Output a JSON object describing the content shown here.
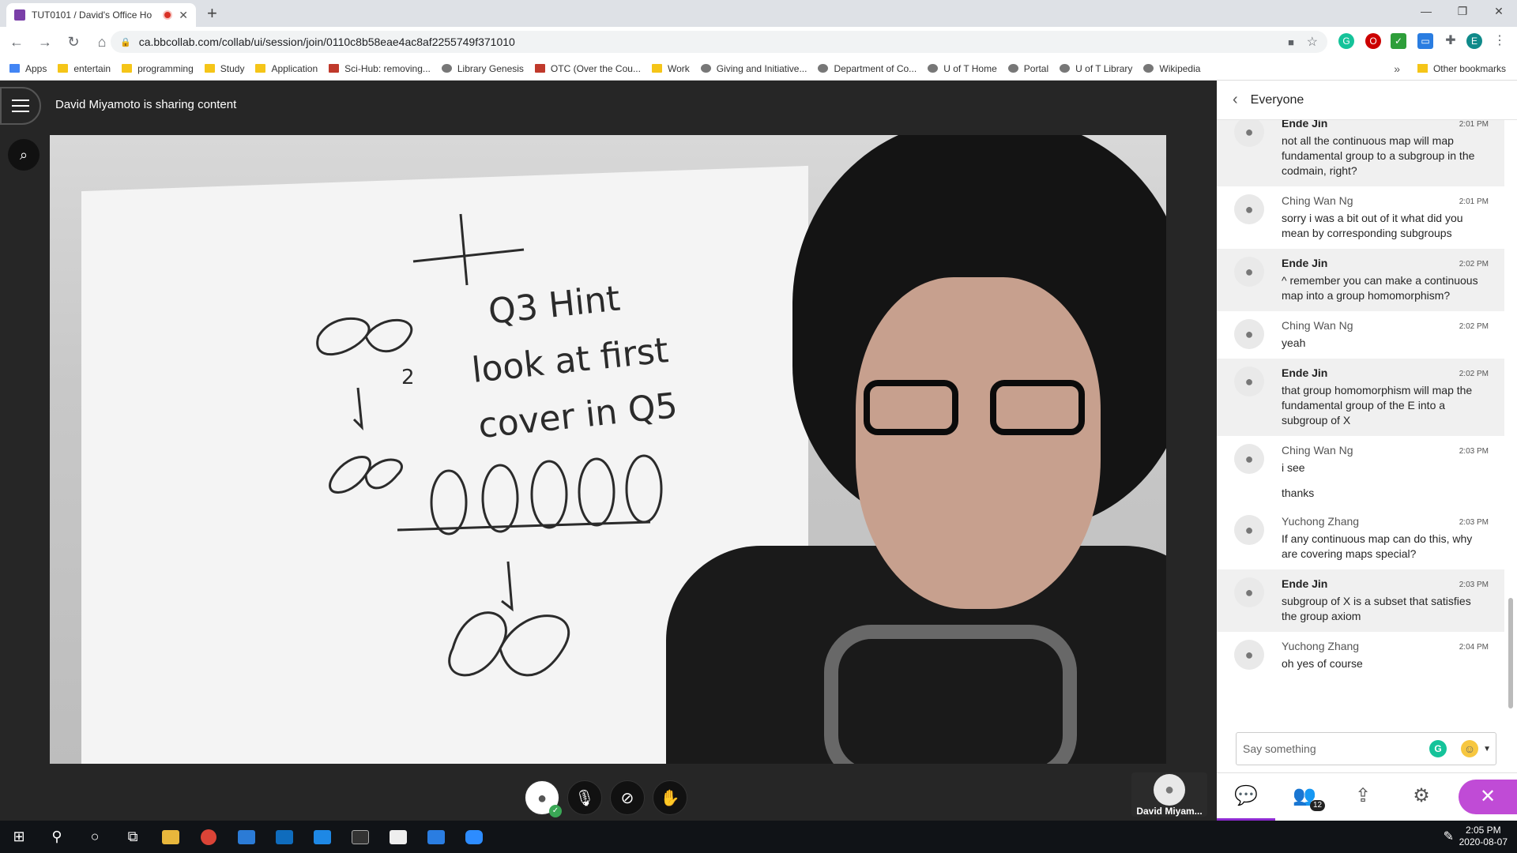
{
  "browser": {
    "tab_title": "TUT0101 / David's Office Ho",
    "new_tab": "+",
    "url": "ca.bbcollab.com/collab/ui/session/join/0110c8b58eae4ac8af2255749f371010",
    "profile_initial": "E"
  },
  "bookmarks": [
    {
      "label": "Apps",
      "icon": "apps-grid-icon"
    },
    {
      "label": "entertain",
      "icon": "folder-icon"
    },
    {
      "label": "programming",
      "icon": "folder-icon"
    },
    {
      "label": "Study",
      "icon": "folder-icon"
    },
    {
      "label": "Application",
      "icon": "folder-icon"
    },
    {
      "label": "Sci-Hub: removing...",
      "icon": "scihub-icon"
    },
    {
      "label": "Library Genesis",
      "icon": "libgen-icon"
    },
    {
      "label": "OTC (Over the Cou...",
      "icon": "otc-icon"
    },
    {
      "label": "Work",
      "icon": "folder-icon"
    },
    {
      "label": "Giving and Initiative...",
      "icon": "giving-icon"
    },
    {
      "label": "Department of Co...",
      "icon": "globe-icon"
    },
    {
      "label": "U of T Home",
      "icon": "uoft-icon"
    },
    {
      "label": "Portal",
      "icon": "blackboard-icon"
    },
    {
      "label": "U of T Library",
      "icon": "library-icon"
    },
    {
      "label": "Wikipedia",
      "icon": "wikipedia-icon"
    }
  ],
  "bookmarks_more": "»",
  "other_bookmarks": "Other bookmarks",
  "session": {
    "sharing_text": "David Miyamoto is sharing content",
    "presenter_tile_name": "David Miyam..."
  },
  "whiteboard": {
    "line1": "Q3 Hint",
    "line2": "look at first",
    "line3": "cover in Q5",
    "arrow_label": "2"
  },
  "chat": {
    "header": "Everyone",
    "messages": [
      {
        "name": "Ende Jin",
        "time": "2:01 PM",
        "text": "not all the continuous map will map fundamental group to a subgroup in the codmain, right?",
        "shaded": true
      },
      {
        "name": "Ching Wan Ng",
        "time": "2:01 PM",
        "text": "sorry i was a bit out of it what did you mean by corresponding subgroups",
        "shaded": false
      },
      {
        "name": "Ende Jin",
        "time": "2:02 PM",
        "text": "^ remember you can make a continuous map into a group homomorphism?",
        "shaded": true
      },
      {
        "name": "Ching Wan Ng",
        "time": "2:02 PM",
        "text": "yeah",
        "shaded": false
      },
      {
        "name": "Ende Jin",
        "time": "2:02 PM",
        "text": "that group homomorphism will map the fundamental group of the E into a subgroup of X",
        "shaded": true
      },
      {
        "name": "Ching Wan Ng",
        "time": "2:03 PM",
        "text": "i see",
        "text2": "thanks",
        "shaded": false
      },
      {
        "name": "Yuchong Zhang",
        "time": "2:03 PM",
        "text": "If any continuous map can do this, why are covering maps special?",
        "shaded": false
      },
      {
        "name": "Ende Jin",
        "time": "2:03 PM",
        "text": "subgroup of X is a subset that satisfies the group axiom",
        "shaded": true
      },
      {
        "name": "Yuchong Zhang",
        "time": "2:04 PM",
        "text": "oh yes of course",
        "shaded": false
      }
    ],
    "input_placeholder": "Say something",
    "participants_count": "12"
  },
  "taskbar": {
    "time": "2:05 PM",
    "date": "2020-08-07"
  }
}
